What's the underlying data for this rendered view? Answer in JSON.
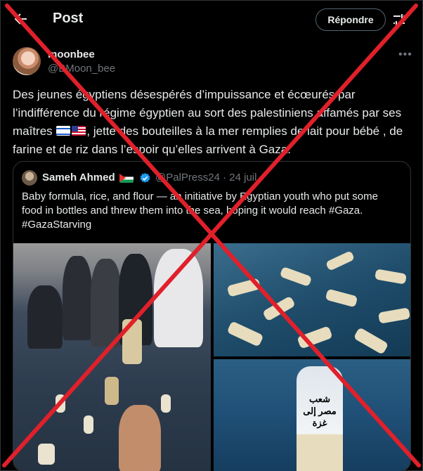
{
  "header": {
    "title": "Post",
    "reply_label": "Répondre"
  },
  "author": {
    "display_name": "moonbee",
    "handle": "@BMoon_bee"
  },
  "tweet": {
    "text_part1": "Des jeunes égyptiens désespérés d’impuissance et écœurés par l’indifférence du régime égyptien au sort des palestiniens affamés par ses maîtres ",
    "text_part2": ", jette des bouteilles à la mer remplies de lait pour bébé , de farine et de riz dans l’espoir qu’elles arrivent à Gaza.",
    "flags": [
      "israel-flag-emoji",
      "us-flag-emoji"
    ]
  },
  "quoted": {
    "display_name": "Sameh Ahmed",
    "handle_date": "@PalPress24 · 24 juil.",
    "text": "Baby formula, rice, and flour — an initiative by Egyptian youth who put some food in bottles and threw them into the sea, hoping it would reach #Gaza. #GazaStarving",
    "bottle_label": "شعب مصر إلى غزة",
    "images": [
      "people-throwing-bottles-photo",
      "floating-bottles-photo",
      "bottle-closeup-photo"
    ]
  },
  "overlay": {
    "cross_color": "#e0202a"
  },
  "colors": {
    "background": "#000000",
    "text": "#e7e9ea",
    "secondary": "#71767b",
    "verified": "#1d9bf0"
  }
}
